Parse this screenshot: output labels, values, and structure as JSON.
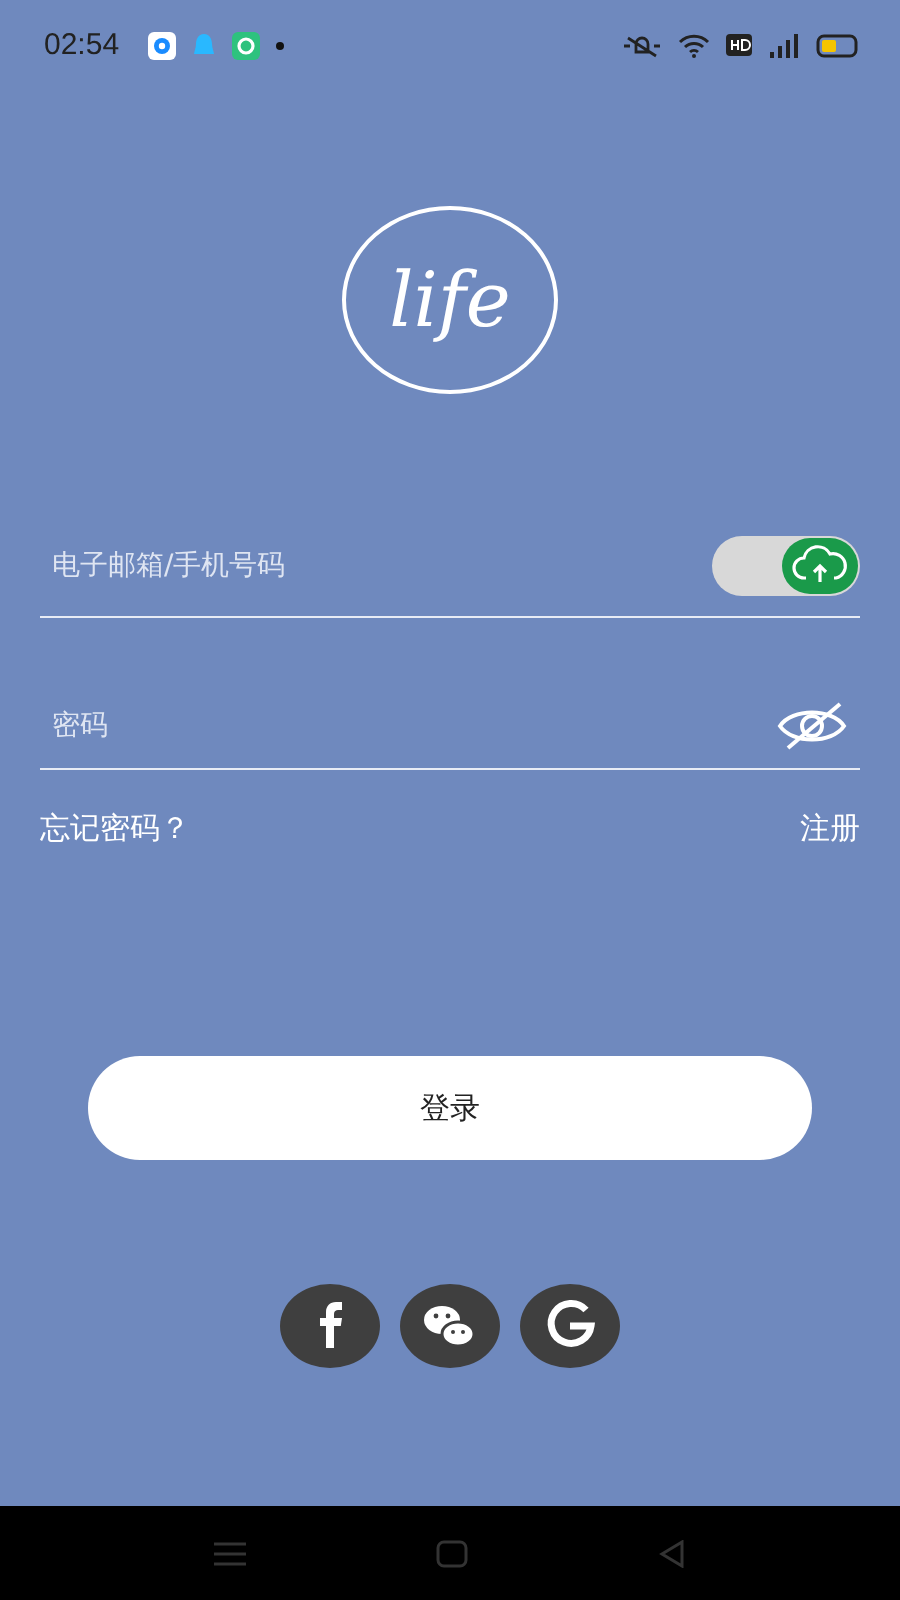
{
  "status_bar": {
    "time": "02:54"
  },
  "logo": {
    "text": "life"
  },
  "email_field": {
    "placeholder": "电子邮箱/手机号码",
    "cloud_toggle": {
      "on": true
    }
  },
  "password_field": {
    "placeholder": "密码",
    "visible": false
  },
  "forgot_link": "忘记密码？",
  "register_link": "注册",
  "login_button": "登录",
  "social_logins": [
    {
      "kind": "facebook"
    },
    {
      "kind": "wechat"
    },
    {
      "kind": "google"
    }
  ]
}
